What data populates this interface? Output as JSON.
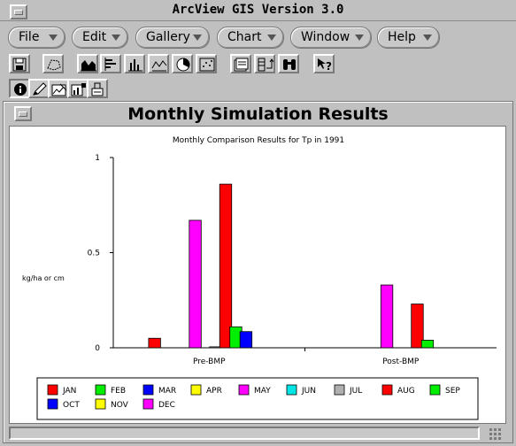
{
  "app": {
    "title": "ArcView GIS Version 3.0"
  },
  "menubar": [
    {
      "label": "File"
    },
    {
      "label": "Edit"
    },
    {
      "label": "Gallery"
    },
    {
      "label": "Chart"
    },
    {
      "label": "Window"
    },
    {
      "label": "Help"
    }
  ],
  "chart_window": {
    "title": "Monthly Simulation Results"
  },
  "chart_data": {
    "type": "bar",
    "title": "Monthly Comparison Results for Tp in 1991",
    "ylabel": "kg/ha or cm",
    "xlabel": "",
    "ylim": [
      0,
      1
    ],
    "y_ticks": [
      "0",
      "0.5",
      "1"
    ],
    "categories": [
      "Pre-BMP",
      "Post-BMP"
    ],
    "series": [
      {
        "name": "JAN",
        "color": "#ff0000",
        "values": [
          0.05,
          0
        ]
      },
      {
        "name": "FEB",
        "color": "#00ee00",
        "values": [
          0,
          0
        ]
      },
      {
        "name": "MAR",
        "color": "#0000ff",
        "values": [
          0,
          0
        ]
      },
      {
        "name": "APR",
        "color": "#ffff00",
        "values": [
          0,
          0
        ]
      },
      {
        "name": "MAY",
        "color": "#ff00ff",
        "values": [
          0.67,
          0.33
        ]
      },
      {
        "name": "JUN",
        "color": "#00e5e5",
        "values": [
          0,
          0
        ]
      },
      {
        "name": "JUL",
        "color": "#b0b0b0",
        "values": [
          0.005,
          0
        ]
      },
      {
        "name": "AUG",
        "color": "#ff0000",
        "values": [
          0.86,
          0.23
        ]
      },
      {
        "name": "SEP",
        "color": "#00ee00",
        "values": [
          0.11,
          0.04
        ]
      },
      {
        "name": "OCT",
        "color": "#0000ff",
        "values": [
          0.085,
          0
        ]
      },
      {
        "name": "NOV",
        "color": "#ffff00",
        "values": [
          0,
          0
        ]
      },
      {
        "name": "DEC",
        "color": "#ff00ff",
        "values": [
          0,
          0
        ]
      }
    ],
    "legend": "bottom"
  }
}
